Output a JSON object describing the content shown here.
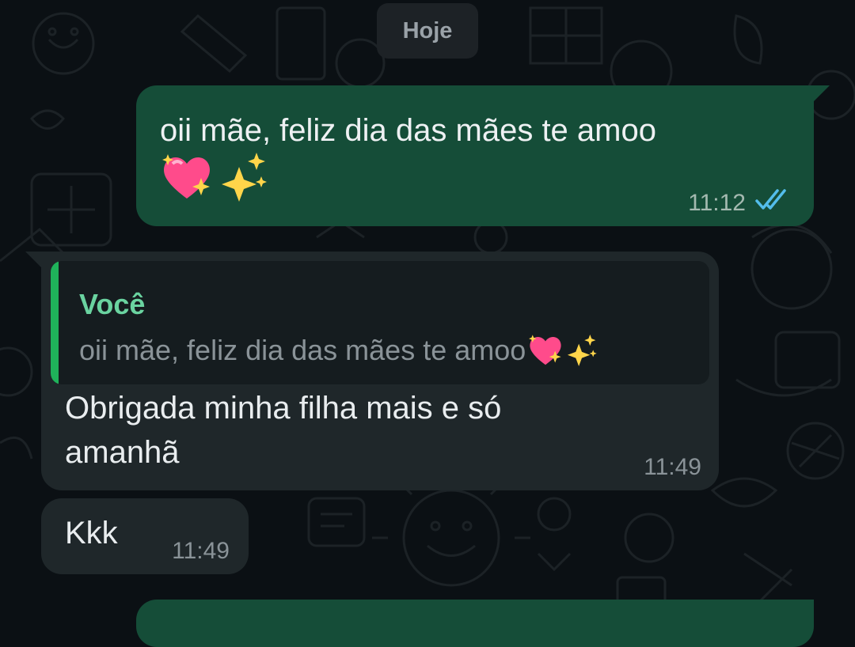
{
  "date_chip": "Hoje",
  "messages": {
    "outgoing_1": {
      "text": "oii mãe, feliz dia das mães te amoo",
      "emojis": [
        "sparkling-heart",
        "sparkles"
      ],
      "time": "11:12",
      "status": "read"
    },
    "incoming_1": {
      "quote_author": "Você",
      "quote_text": "oii mãe, feliz dia das mães te amoo",
      "quote_emojis": [
        "sparkling-heart",
        "sparkles"
      ],
      "text": "Obrigada minha filha mais e só amanhã",
      "time": "11:49"
    },
    "incoming_2": {
      "text": "Kkk",
      "time": "11:49"
    }
  },
  "colors": {
    "background": "#0b1014",
    "outgoing_bubble": "#154d38",
    "incoming_bubble": "#1f272a",
    "quote_accent": "#1fb25a",
    "read_ticks": "#53bdeb"
  }
}
